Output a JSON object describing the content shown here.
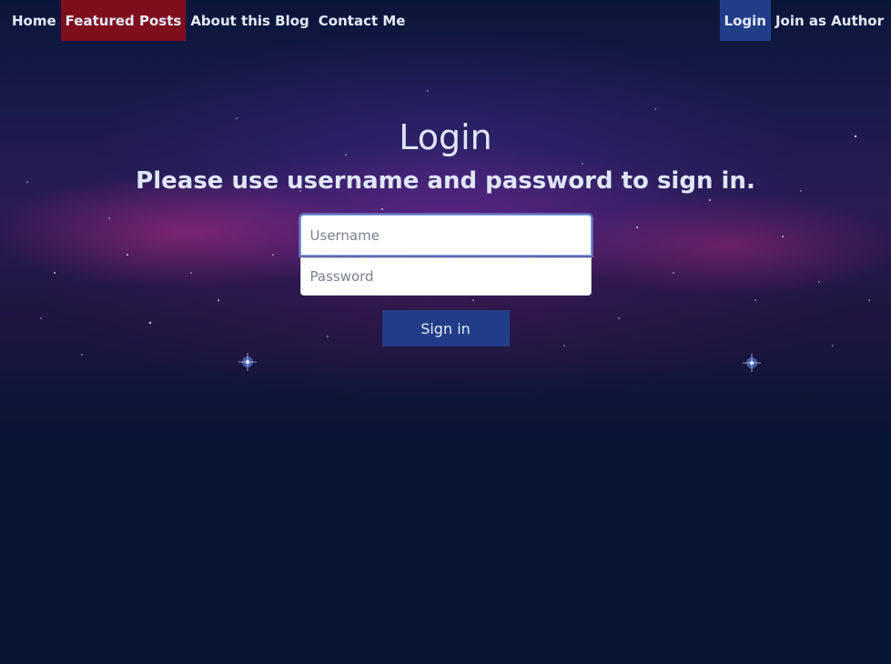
{
  "nav": {
    "left": [
      {
        "label": "Home"
      },
      {
        "label": "Featured Posts"
      },
      {
        "label": "About this Blog"
      },
      {
        "label": "Contact Me"
      }
    ],
    "right": [
      {
        "label": "Login"
      },
      {
        "label": "Join as Author"
      }
    ]
  },
  "login": {
    "title": "Login",
    "subtitle": "Please use username and password to sign in.",
    "username_placeholder": "Username",
    "password_placeholder": "Password",
    "signin_label": "Sign in"
  },
  "colors": {
    "background": "#081535",
    "featured_highlight": "#7f0e1d",
    "active_highlight": "#223d88",
    "button": "#223d88",
    "text": "#dfe6f8"
  }
}
